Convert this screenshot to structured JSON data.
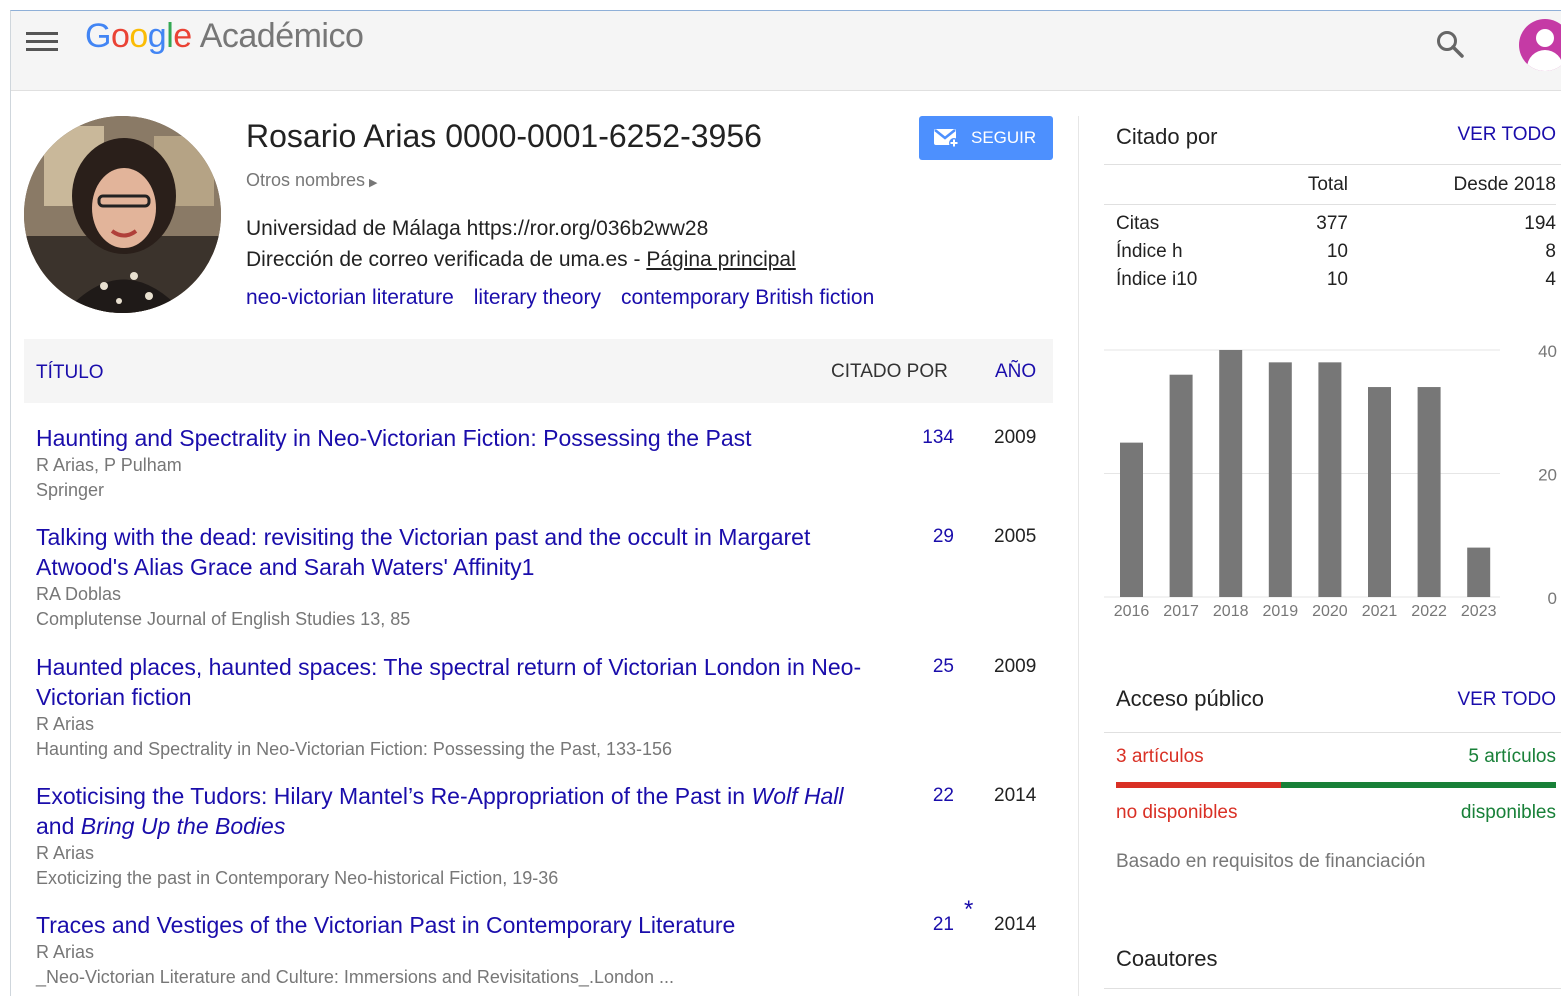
{
  "header": {
    "logo": [
      "G",
      "o",
      "o",
      "g",
      "l",
      "e"
    ],
    "product": "Académico"
  },
  "profile": {
    "name": "Rosario Arias 0000-0001-6252-3956",
    "other_names": "Otros nombres",
    "affiliation": "Universidad de Málaga https://ror.org/036b2ww28",
    "email_text": "Dirección de correo verificada de uma.es - ",
    "homepage_label": "Página principal",
    "interests": [
      "neo-victorian literature",
      "literary theory",
      "contemporary British fiction"
    ],
    "follow_label": "SEGUIR"
  },
  "table": {
    "col_title": "TÍTULO",
    "col_cited": "CITADO POR",
    "col_year": "AÑO"
  },
  "articles": [
    {
      "title": "Haunting and Spectrality in Neo-Victorian Fiction: Possessing the Past",
      "authors": "R Arias, P Pulham",
      "venue": "Springer",
      "cited": "134",
      "year": "2009",
      "star": ""
    },
    {
      "title": "Talking with the dead: revisiting the Victorian past and the occult in Margaret Atwood's Alias Grace and Sarah Waters' Affinity1",
      "authors": "RA Doblas",
      "venue": "Complutense Journal of English Studies 13, 85",
      "cited": "29",
      "year": "2005",
      "star": ""
    },
    {
      "title": "Haunted places, haunted spaces: The spectral return of Victorian London in Neo-Victorian fiction",
      "authors": "R Arias",
      "venue": "Haunting and Spectrality in Neo-Victorian Fiction: Possessing the Past, 133-156",
      "cited": "25",
      "year": "2009",
      "star": ""
    },
    {
      "title_parts": [
        "Exoticising the Tudors: Hilary Mantel’s Re-Appropriation of the Past in ",
        "Wolf Hall",
        " and ",
        "Bring Up the Bodies"
      ],
      "authors": "R Arias",
      "venue": "Exoticizing the past in Contemporary Neo-historical Fiction, 19-36",
      "cited": "22",
      "year": "2014",
      "star": ""
    },
    {
      "title": "Traces and Vestiges of the Victorian Past in Contemporary Literature",
      "authors": "R Arias",
      "venue": "_Neo-Victorian Literature and Culture: Immersions and Revisitations_.London ...",
      "cited": "21",
      "year": "2014",
      "star": "*"
    }
  ],
  "cited_by": {
    "heading": "Citado por",
    "view_all": "VER TODO",
    "col_total": "Total",
    "col_since": "Desde 2018",
    "rows": [
      {
        "label": "Citas",
        "total": "377",
        "since": "194"
      },
      {
        "label": "Índice h",
        "total": "10",
        "since": "8"
      },
      {
        "label": "Índice i10",
        "total": "10",
        "since": "4"
      }
    ]
  },
  "chart_data": {
    "type": "bar",
    "categories": [
      "2016",
      "2017",
      "2018",
      "2019",
      "2020",
      "2021",
      "2022",
      "2023"
    ],
    "values": [
      25,
      36,
      40,
      38,
      38,
      34,
      34,
      8
    ],
    "ylim": [
      0,
      40
    ],
    "yticks": [
      "0",
      "20",
      "40"
    ],
    "grid": true,
    "bar_color": "#777777"
  },
  "public_access": {
    "heading": "Acceso público",
    "view_all": "VER TODO",
    "unavailable_count": "3 artículos",
    "available_count": "5 artículos",
    "unavailable_label": "no disponibles",
    "available_label": "disponibles",
    "unavailable_fraction": 0.375,
    "note": "Basado en requisitos de financiación",
    "unavailable_color": "#d93025",
    "available_color": "#188038"
  },
  "coauthors": {
    "heading": "Coautores"
  }
}
